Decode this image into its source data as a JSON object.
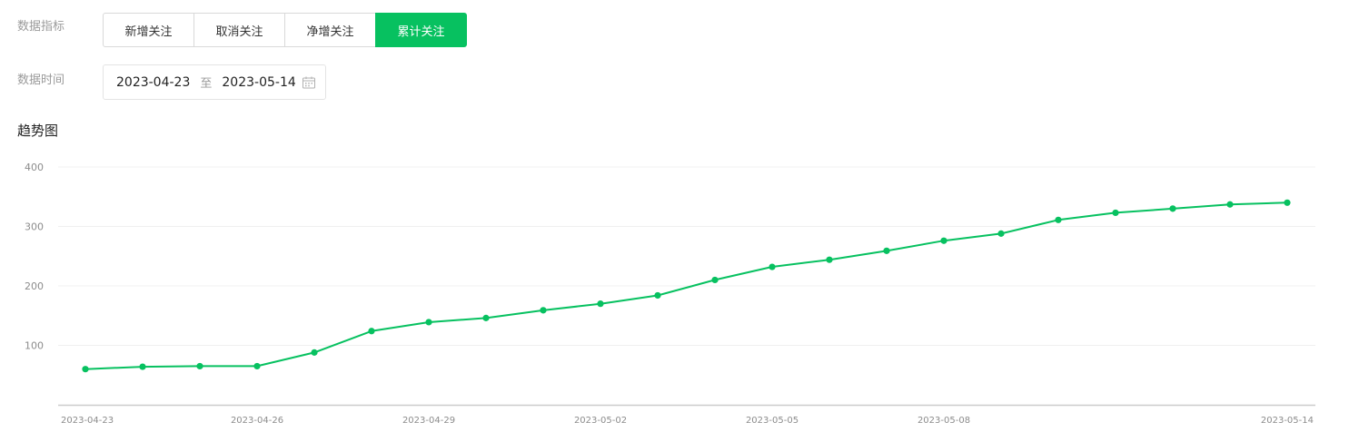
{
  "filters": {
    "metric_label": "数据指标",
    "metric_options": [
      "新增关注",
      "取消关注",
      "净增关注",
      "累计关注"
    ],
    "active_metric_index": 3,
    "time_label": "数据时间",
    "date_start": "2023-04-23",
    "date_separator": "至",
    "date_end": "2023-05-14"
  },
  "section_title": "趋势图",
  "colors": {
    "accent": "#07c160",
    "grid": "#f0f0f0",
    "axis": "#cccccc"
  },
  "icons": {
    "calendar": "calendar-icon"
  },
  "chart_data": {
    "type": "line",
    "x": [
      "2023-04-23",
      "2023-04-24",
      "2023-04-25",
      "2023-04-26",
      "2023-04-27",
      "2023-04-28",
      "2023-04-29",
      "2023-04-30",
      "2023-05-01",
      "2023-05-02",
      "2023-05-03",
      "2023-05-04",
      "2023-05-05",
      "2023-05-06",
      "2023-05-07",
      "2023-05-08",
      "2023-05-09",
      "2023-05-10",
      "2023-05-11",
      "2023-05-12",
      "2023-05-13",
      "2023-05-14"
    ],
    "series": [
      {
        "values": [
          60,
          64,
          65,
          65,
          88,
          124,
          139,
          146,
          159,
          170,
          184,
          210,
          232,
          244,
          259,
          276,
          288,
          311,
          323,
          330,
          337,
          340
        ]
      }
    ],
    "x_tick_labels": [
      "2023-04-23",
      "2023-04-26",
      "2023-04-29",
      "2023-05-02",
      "2023-05-05",
      "2023-05-08",
      "2023-05-14"
    ],
    "y_ticks": [
      100,
      200,
      300,
      400
    ],
    "ylim": [
      0,
      400
    ],
    "grid": true,
    "title": "",
    "xlabel": "",
    "ylabel": ""
  }
}
